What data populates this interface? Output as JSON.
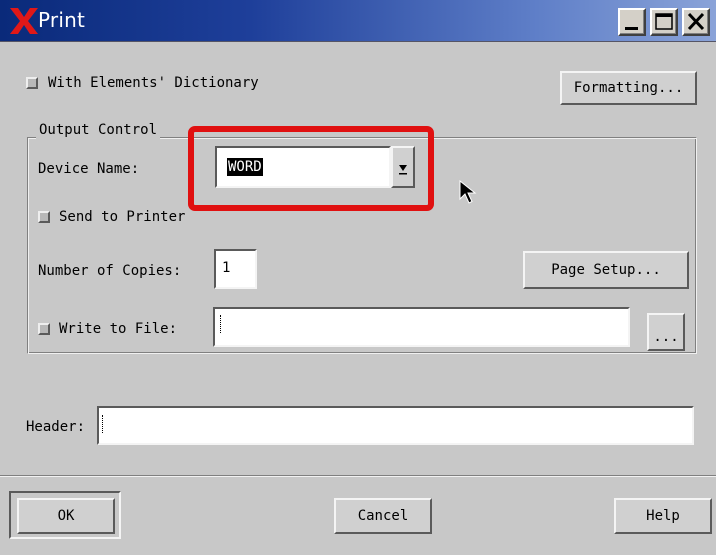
{
  "window": {
    "title": "Print",
    "logo_icon": "x-logo-icon",
    "controls": {
      "minimize": "minimize-icon",
      "maximize": "maximize-icon",
      "close": "close-icon"
    }
  },
  "options": {
    "with_elements_dictionary": {
      "label": "With Elements' Dictionary",
      "checked": false
    },
    "formatting_button": "Formatting..."
  },
  "output_control": {
    "legend": "Output Control",
    "device_name": {
      "label": "Device Name:",
      "value": "WORD",
      "dropdown_icon": "dropdown-arrow-icon"
    },
    "send_to_printer": {
      "label": "Send to Printer",
      "checked": false
    },
    "number_of_copies": {
      "label": "Number of Copies:",
      "value": "1"
    },
    "page_setup_button": "Page Setup...",
    "write_to_file": {
      "label": "Write to File:",
      "checked": false,
      "value": ""
    },
    "browse_button": "..."
  },
  "header": {
    "label": "Header:",
    "value": ""
  },
  "buttons": {
    "ok": "OK",
    "cancel": "Cancel",
    "help": "Help"
  },
  "annotation": {
    "highlight_color": "#e01010",
    "target": "device-name-combo"
  }
}
